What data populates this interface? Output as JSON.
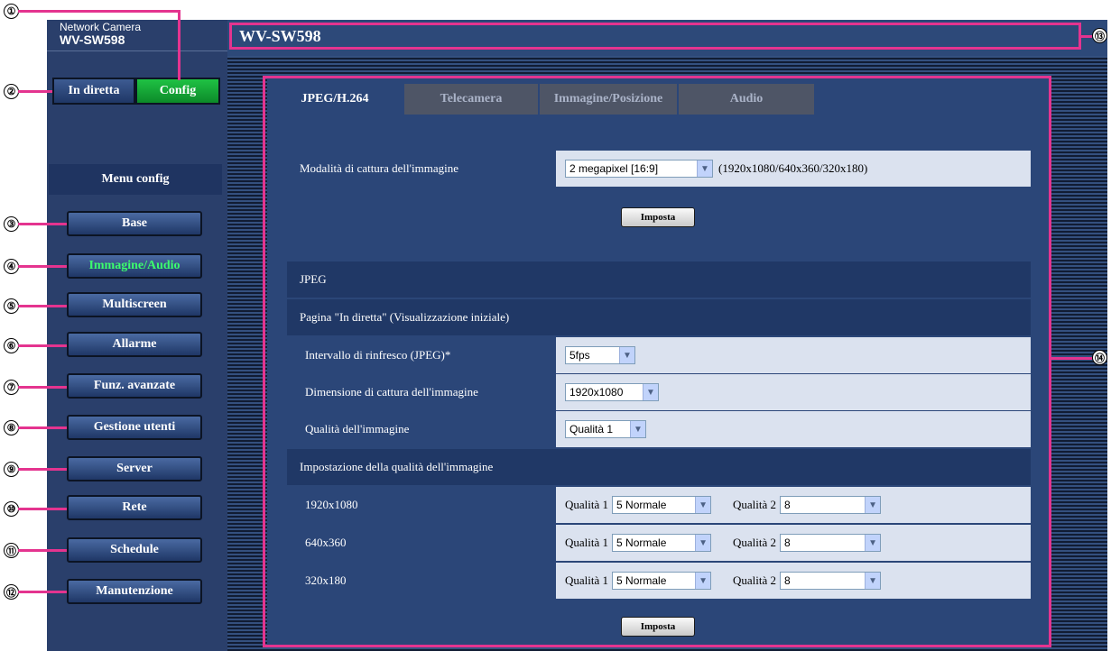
{
  "camera": {
    "label": "Network Camera",
    "model": "WV-SW598"
  },
  "header": {
    "title": "WV-SW598"
  },
  "top_buttons": {
    "live": "In diretta",
    "config": "Config"
  },
  "menu": {
    "title": "Menu config",
    "items": [
      "Base",
      "Immagine/Audio",
      "Multiscreen",
      "Allarme",
      "Funz. avanzate",
      "Gestione utenti",
      "Server",
      "Rete",
      "Schedule",
      "Manutenzione"
    ],
    "active": "Immagine/Audio"
  },
  "tabs": [
    "JPEG/H.264",
    "Telecamera",
    "Immagine/Posizione",
    "Audio"
  ],
  "capture_mode": {
    "label": "Modalità di cattura dell'immagine",
    "value": "2 megapixel [16:9]",
    "note": "(1920x1080/640x360/320x180)"
  },
  "set_button": "Imposta",
  "jpeg": {
    "section": "JPEG",
    "live_page": "Pagina \"In diretta\" (Visualizzazione iniziale)",
    "refresh_label": "Intervallo di rinfresco (JPEG)*",
    "refresh_value": "5fps",
    "capture_size_label": "Dimensione di cattura dell'immagine",
    "capture_size_value": "1920x1080",
    "quality_label": "Qualità dell'immagine",
    "quality_value": "Qualità 1",
    "quality_settings": "Impostazione della qualità dell'immagine",
    "q1_label": "Qualità 1",
    "q2_label": "Qualità 2",
    "rows": [
      {
        "res": "1920x1080",
        "q1": "5 Normale",
        "q2": "8"
      },
      {
        "res": "640x360",
        "q1": "5 Normale",
        "q2": "8"
      },
      {
        "res": "320x180",
        "q1": "5 Normale",
        "q2": "8"
      }
    ]
  },
  "callouts": [
    "①",
    "②",
    "③",
    "④",
    "⑤",
    "⑥",
    "⑦",
    "⑧",
    "⑨",
    "⑩",
    "⑪",
    "⑫",
    "⑬",
    "⑭"
  ],
  "colors": {
    "annotation": "#e4348f",
    "nav_panel": "#2a3f6b",
    "config_active": "#0c8a29",
    "active_menu_text": "#3cff6e"
  }
}
